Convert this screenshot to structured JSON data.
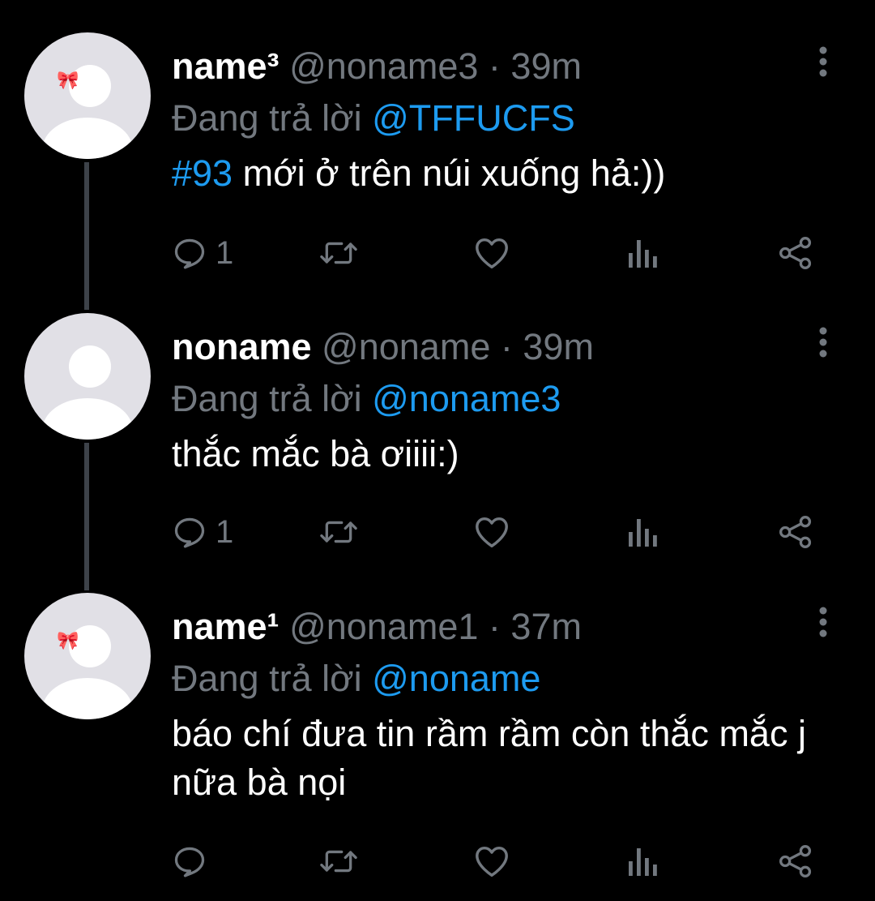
{
  "tweets": [
    {
      "name": "name³",
      "handle": "@noname3",
      "separator": "·",
      "time": "39m",
      "reply_prefix": "Đang trả lời",
      "reply_to": "@TFFUCFS",
      "hashtag": "#93",
      "text": " mới ở trên núi xuống hả:))",
      "reply_count": "1",
      "avatar_bow": "🎀"
    },
    {
      "name": "noname",
      "handle": "@noname",
      "separator": "·",
      "time": "39m",
      "reply_prefix": "Đang trả lời",
      "reply_to": "@noname3",
      "text": "thắc mắc bà ơiiii:)",
      "reply_count": "1"
    },
    {
      "name": "name¹",
      "handle": "@noname1",
      "separator": "·",
      "time": "37m",
      "reply_prefix": "Đang trả lời",
      "reply_to": "@noname",
      "text": "báo chí đưa tin rầm rầm còn thắc mắc j nữa bà nọi",
      "reply_count": "",
      "avatar_bow": "🎀"
    }
  ],
  "icons": {
    "reply": "reply-icon",
    "retweet": "retweet-icon",
    "like": "heart-icon",
    "views": "analytics-icon",
    "share": "share-icon",
    "more": "more-icon"
  },
  "colors": {
    "background": "#000000",
    "text": "#ffffff",
    "secondary": "#72787f",
    "accent": "#1d9bf0",
    "thread_line": "#3d4249",
    "avatar_bg": "#e1e0e6"
  }
}
